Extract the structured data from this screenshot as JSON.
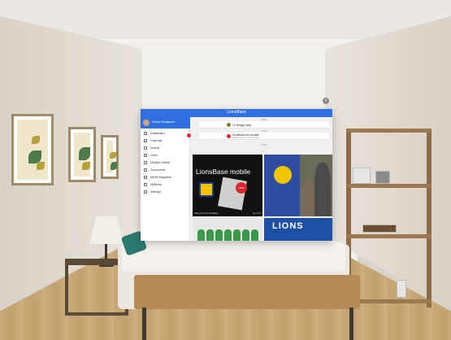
{
  "app": {
    "title": "LionsBase",
    "profile_name": "Sacha Ferrigarum",
    "nav": [
      {
        "label": "Dashboard",
        "icon": "dashboard-icon"
      },
      {
        "label": "Calendar",
        "icon": "calendar-icon"
      },
      {
        "label": "Search",
        "icon": "search-icon"
      },
      {
        "label": "Clubs",
        "icon": "clubs-icon"
      },
      {
        "label": "Multiple District",
        "icon": "district-icon"
      },
      {
        "label": "Documents",
        "icon": "documents-icon"
      },
      {
        "label": "MD99 Magazine",
        "icon": "magazine-icon"
      },
      {
        "label": "MyNews",
        "icon": "news-icon"
      },
      {
        "label": "Settings",
        "icon": "settings-icon"
      }
    ],
    "feed": {
      "header_1": "Today",
      "item_1": {
        "text": "LC Bougy-Lullig",
        "sub": ""
      },
      "header_2": "Today",
      "item_2": {
        "text": "Conférence de synodie",
        "sub": "Multiple District · 12 Sept. 2021"
      },
      "header_3": "Today"
    },
    "tiles": {
      "main_title": "LionsBase mobile",
      "main_caption": "Take your own LionsBase",
      "main_date": "Sep 2021",
      "badge": "NEW",
      "banner_text": "LIONS"
    },
    "colors": {
      "accent": "#2f6fe0",
      "alert": "#d8262a",
      "lions_yellow": "#f4c300"
    }
  }
}
